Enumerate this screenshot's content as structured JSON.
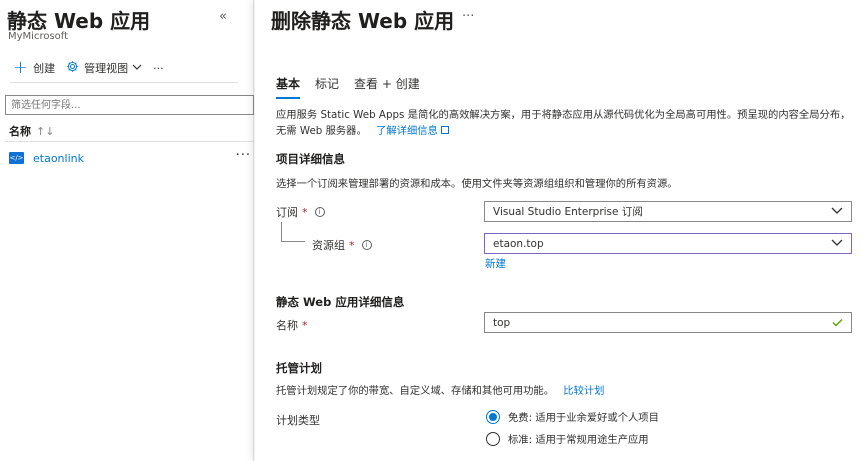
{
  "left": {
    "title": "静态 Web 应用",
    "subtitle": "MyMicrosoft",
    "collapse_glyph": "«",
    "toolbar": {
      "create_label": "创建",
      "manage_view_label": "管理视图",
      "more_glyph": "···"
    },
    "filter_placeholder": "筛选任何字段...",
    "column_header": "名称",
    "sort_glyph": "↑↓",
    "rows": [
      {
        "name": "etaonlink",
        "more": "···"
      }
    ]
  },
  "right": {
    "title": "删除静态 Web 应用",
    "more_glyph": "···",
    "tabs": [
      {
        "label": "基本",
        "active": true
      },
      {
        "label": "标记",
        "active": false
      },
      {
        "label": "查看 + 创建",
        "active": false
      }
    ],
    "description": "应用服务 Static Web Apps 是简化的高效解决方案，用于将静态应用从源代码优化为全局高可用性。预呈现的内容全局分布，无需 Web 服务器。",
    "learn_more": "了解详细信息",
    "project": {
      "heading": "项目详细信息",
      "desc": "选择一个订阅来管理部署的资源和成本。使用文件夹等资源组组织和管理你的所有资源。",
      "subscription_label": "订阅",
      "subscription_value": "Visual Studio Enterprise 订阅",
      "resource_group_label": "资源组",
      "resource_group_value": "etaon.top",
      "new_link": "新建"
    },
    "app_details": {
      "heading": "静态 Web 应用详细信息",
      "name_label": "名称",
      "name_value": "top"
    },
    "hosting": {
      "heading": "托管计划",
      "desc": "托管计划规定了你的带宽、自定义域、存储和其他可用功能。",
      "compare_link": "比较计划",
      "plan_type_label": "计划类型",
      "options": [
        {
          "label": "免费: 适用于业余爱好或个人项目",
          "selected": true
        },
        {
          "label": "标准: 适用于常规用途生产应用",
          "selected": false
        }
      ]
    },
    "required_mark": "*",
    "info_glyph": "i"
  },
  "colors": {
    "accent": "#0078d4",
    "required": "#a4262c",
    "valid_check": "#57a300",
    "focus_border": "#8661c5"
  }
}
